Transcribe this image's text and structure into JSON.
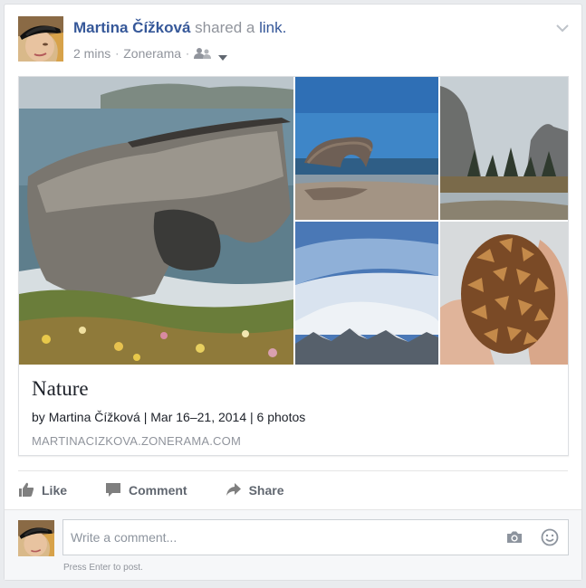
{
  "post": {
    "author": "Martina Čížková",
    "action_text": "shared a",
    "link_word": "link.",
    "time": "2 mins",
    "separator": "·",
    "via": "Zonerama",
    "audience_icon": "friends-icon"
  },
  "attachment": {
    "title": "Nature",
    "by_label": "by",
    "by_name": "Martina Čížková",
    "details": "| Mar 16–21, 2014 | 6 photos",
    "domain": "MARTINACIZKOVA.ZONERAMA.COM"
  },
  "actions": {
    "like": "Like",
    "comment": "Comment",
    "share": "Share"
  },
  "composer": {
    "placeholder": "Write a comment...",
    "hint": "Press Enter to post."
  },
  "colors": {
    "link_blue": "#365899",
    "muted": "#90949c",
    "action_gray": "#616770"
  }
}
